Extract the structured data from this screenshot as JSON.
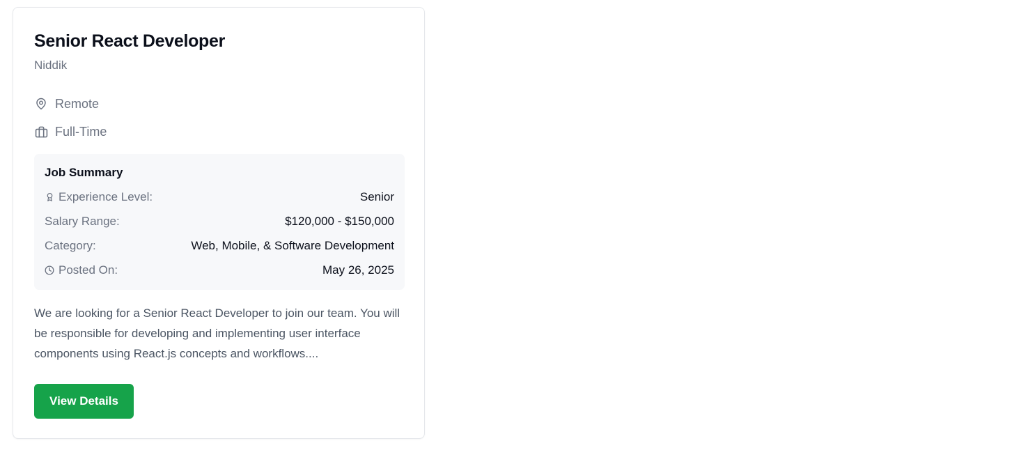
{
  "job": {
    "title": "Senior React Developer",
    "company": "Niddik",
    "location": "Remote",
    "employment_type": "Full-Time",
    "icons": {
      "location": "map-pin-icon",
      "employment_type": "briefcase-icon"
    }
  },
  "summary": {
    "heading": "Job Summary",
    "rows": [
      {
        "label": "Experience Level:",
        "value": "Senior",
        "icon": "award-icon"
      },
      {
        "label": "Salary Range:",
        "value": "$120,000 - $150,000",
        "icon": ""
      },
      {
        "label": "Category:",
        "value": "Web, Mobile, & Software Development",
        "icon": ""
      },
      {
        "label": "Posted On:",
        "value": "May 26, 2025",
        "icon": "clock-icon"
      }
    ]
  },
  "description": "We are looking for a Senior React Developer to join our team. You will be responsible for developing and implementing user interface components using React.js concepts and workflows....",
  "actions": {
    "view_details_label": "View Details"
  },
  "colors": {
    "accent": "#16a34a",
    "title_text": "#0b0f1a",
    "muted_text": "#6b7280",
    "summary_bg": "#f7f8fa",
    "card_border": "#e5e7eb"
  }
}
